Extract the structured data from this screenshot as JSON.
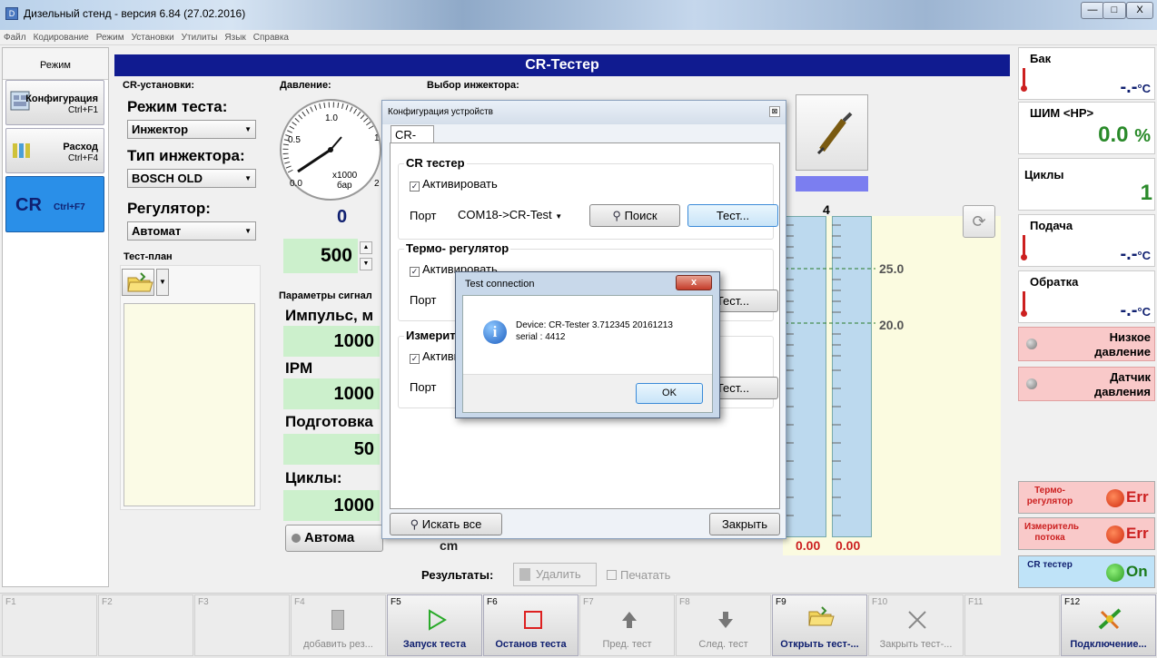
{
  "window": {
    "title": "Дизельный стенд - версия 6.84 (27.02.2016)",
    "min": "—",
    "max": "□",
    "close": "X"
  },
  "menu": [
    "Файл",
    "Кодирование",
    "Режим",
    "Установки",
    "Утилиты",
    "Язык",
    "Справка"
  ],
  "left": {
    "header": "Режим",
    "config": {
      "label": "Конфигурация",
      "key": "Ctrl+F1"
    },
    "flow": {
      "label": "Расход",
      "key": "Ctrl+F4"
    },
    "cr": {
      "label": "CR",
      "key": "Ctrl+F7"
    }
  },
  "header": "CR-Тестер",
  "cr_setup": {
    "title": "CR-установки:",
    "mode_label": "Режим теста:",
    "mode_value": "Инжектор",
    "injtype_label": "Тип инжектора:",
    "injtype_value": "BOSCH OLD",
    "reg_label": "Регулятор:",
    "reg_value": "Автомат",
    "testplan": "Тест-план"
  },
  "pressure": {
    "title": "Давление:",
    "gauge_ticks": [
      "0.5",
      "1.0",
      "1",
      "2",
      "0.0"
    ],
    "gauge_unit1": "x1000",
    "gauge_unit2": "бар",
    "value": "0",
    "setpoint": "500"
  },
  "signal": {
    "title": "Параметры сигнал",
    "pulse_label": "Импульс, м",
    "pulse_value": "1000",
    "ipm_label": "IPM",
    "ipm_value": "1000",
    "prep_label": "Подготовка",
    "prep_value": "50",
    "cycles_label": "Циклы:",
    "cycles_value": "1000",
    "auto_btn": "Автома"
  },
  "injector": {
    "title": "Выбор инжектора:"
  },
  "chart": {
    "col_label": "4",
    "line1": "25.0",
    "line2": "20.0",
    "row_label": "cm",
    "zero": "0.00"
  },
  "results": {
    "label": "Результаты:",
    "delete": "Удалить",
    "print": "Печатать"
  },
  "right": {
    "tank": {
      "label": "Бак",
      "value": "-.-",
      "unit": "°C"
    },
    "pwm": {
      "label": "ШИМ <HP>",
      "value": "0.0",
      "unit": "%"
    },
    "cycles": {
      "label": "Циклы",
      "value": "1"
    },
    "supply": {
      "label": "Подача",
      "value": "-.-",
      "unit": "°C"
    },
    "return": {
      "label": "Обратка",
      "value": "-.-",
      "unit": "°C"
    },
    "lowp": "Низкое давление",
    "sensor": "Датчик давления",
    "thermo": {
      "label": "Термо- регулятор",
      "value": "Err"
    },
    "flowm": {
      "label": "Измеритель потока",
      "value": "Err"
    },
    "crt": {
      "label": "CR тестер",
      "value": "On"
    }
  },
  "fkeys": [
    {
      "key": "F1",
      "label": ""
    },
    {
      "key": "F2",
      "label": ""
    },
    {
      "key": "F3",
      "label": ""
    },
    {
      "key": "F4",
      "label": "добавить рез..."
    },
    {
      "key": "F5",
      "label": "Запуск теста"
    },
    {
      "key": "F6",
      "label": "Останов теста"
    },
    {
      "key": "F7",
      "label": "Пред. тест"
    },
    {
      "key": "F8",
      "label": "След. тест"
    },
    {
      "key": "F9",
      "label": "Открыть тест-..."
    },
    {
      "key": "F10",
      "label": "Закрыть тест-..."
    },
    {
      "key": "F11",
      "label": ""
    },
    {
      "key": "F12",
      "label": "Подключение..."
    }
  ],
  "cfg": {
    "title": "Конфигурация устройств",
    "tab": "CR-Jet",
    "crtester": "CR тестер",
    "activate": "Активировать",
    "port": "Порт",
    "port_value": "COM18->CR-Test",
    "search": "Поиск",
    "test": "Тест...",
    "thermo": "Термо- регулятор",
    "activate2": "Активировать",
    "port2": "Порт",
    "test2": "Тест...",
    "meter": "Измерит",
    "activate3": "Активи",
    "port3": "Порт",
    "test3": "Тест...",
    "searchall": "Искать все",
    "close": "Закрыть"
  },
  "msg": {
    "title": "Test connection",
    "line1": "Device: CR-Tester 3.712345 20161213",
    "line2": "serial : 4412",
    "ok": "OK"
  },
  "colors": {
    "header_blue": "#101b90",
    "green_box": "#ccf0cc",
    "alarm_pink": "#f9c9c9"
  }
}
